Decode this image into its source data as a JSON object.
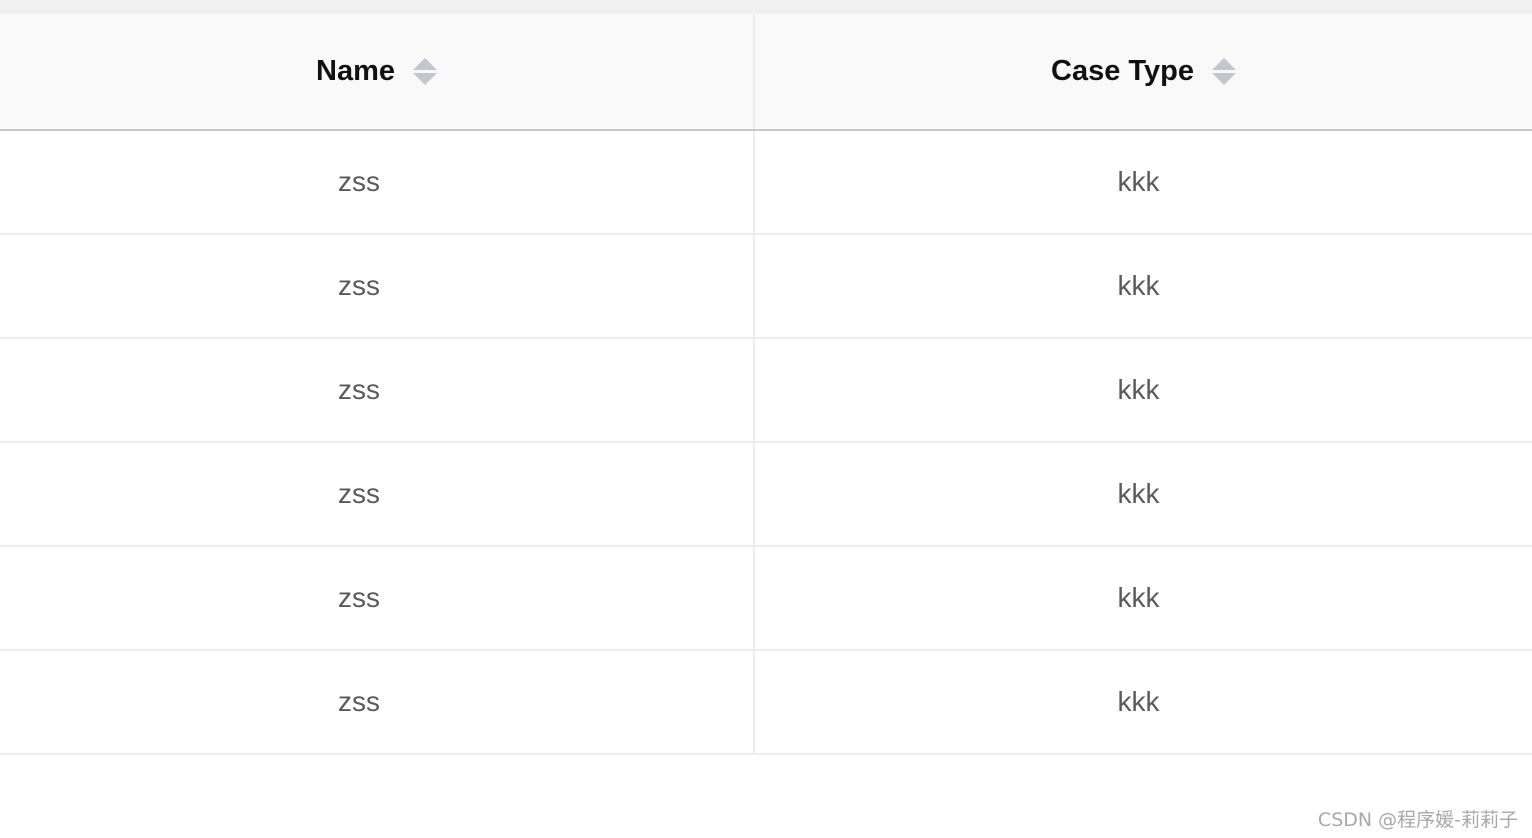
{
  "table": {
    "columns": [
      {
        "label": "Name",
        "sortable": true,
        "sort_icon": "sort-arrows-icon"
      },
      {
        "label": "Case Type",
        "sortable": true,
        "sort_icon": "sort-arrows-icon"
      }
    ],
    "rows": [
      {
        "name": "zss",
        "case_type": "kkk"
      },
      {
        "name": "zss",
        "case_type": "kkk"
      },
      {
        "name": "zss",
        "case_type": "kkk"
      },
      {
        "name": "zss",
        "case_type": "kkk"
      },
      {
        "name": "zss",
        "case_type": "kkk"
      },
      {
        "name": "zss",
        "case_type": "kkk"
      }
    ]
  },
  "watermark": "CSDN @程序媛-莉莉子",
  "colors": {
    "header_bg": "#f9f9f9",
    "cell_text": "#5a5a5a",
    "header_text": "#111111",
    "sort_icon": "#c3c7cf",
    "border": "#ececec"
  }
}
